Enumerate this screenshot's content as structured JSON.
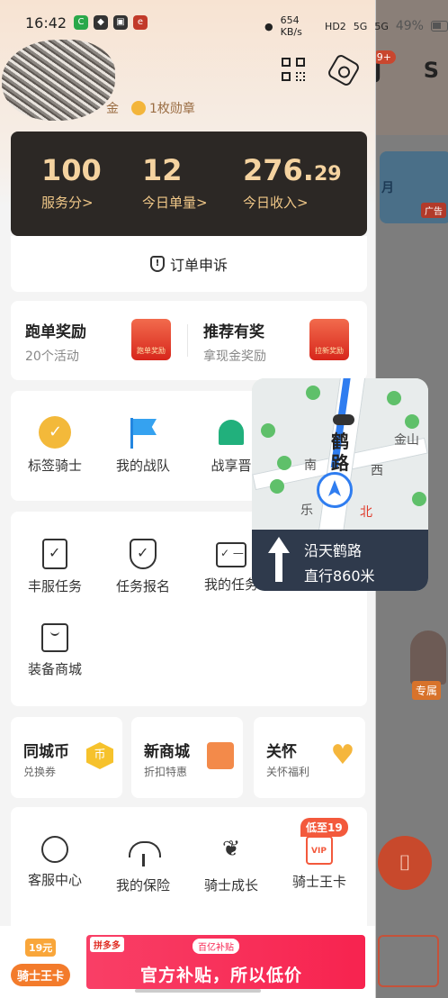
{
  "status_bar": {
    "time": "16:42",
    "net_speed": "654 KB/s",
    "hd": "HD2",
    "signal1": "5G",
    "signal2": "5G",
    "battery": "49%"
  },
  "profile": {
    "gold_label": "金",
    "medal_label": "1枚勋章"
  },
  "stats": [
    {
      "value": "100",
      "decimal": "",
      "label": "服务分>"
    },
    {
      "value": "12",
      "decimal": "",
      "label": "今日单量>"
    },
    {
      "value": "276.",
      "decimal": "29",
      "label": "今日收入>"
    }
  ],
  "appeal": {
    "icon_text": "!",
    "label": "订单申诉"
  },
  "rewards": [
    {
      "title": "跑单奖励",
      "subtitle": "20个活动",
      "image_text": "跑单奖励"
    },
    {
      "title": "推荐有奖",
      "subtitle": "拿现金奖励",
      "image_text": "拉新奖励"
    }
  ],
  "row1": [
    "标签骑士",
    "我的战队",
    "战享晋"
  ],
  "row2": [
    "丰服任务",
    "任务报名",
    "我的任务",
    "装备商城"
  ],
  "mini_cards": [
    {
      "title": "同城币",
      "subtitle": "兑换券",
      "icon_text": "币"
    },
    {
      "title": "新商城",
      "subtitle": "折扣特惠",
      "icon_text": ""
    },
    {
      "title": "关怀",
      "subtitle": "关怀福利",
      "icon_text": "♥"
    }
  ],
  "row3": [
    "客服中心",
    "我的保险",
    "骑士成长",
    "骑士王卡"
  ],
  "low_badge": "低至19",
  "ad": {
    "chip": "19元",
    "left_label": "骑士王卡",
    "pdd": "拼多多",
    "subsidy": "百亿补贴",
    "headline": "官方补贴，所以低价"
  },
  "navigation": {
    "street_vertical": "鹤路",
    "street": "沿天鹤路",
    "direction": "直行860米",
    "map_labels": [
      "金山",
      "南",
      "西",
      "北",
      "乐"
    ]
  },
  "background_app": {
    "badge": "9+",
    "ad_tag": "广告",
    "month": "月",
    "exclusive": "专属"
  }
}
